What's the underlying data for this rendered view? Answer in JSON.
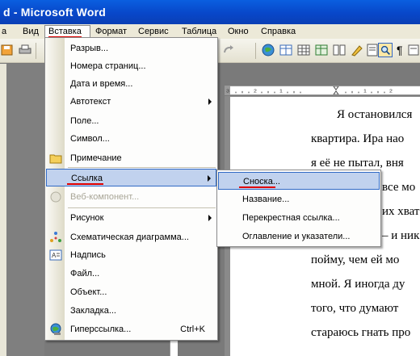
{
  "window": {
    "title": "d - Microsoft Word"
  },
  "menubar": {
    "items": [
      {
        "label": "а"
      },
      {
        "label": "Вид"
      },
      {
        "label": "Вставка"
      },
      {
        "label": "Формат"
      },
      {
        "label": "Сервис"
      },
      {
        "label": "Таблица"
      },
      {
        "label": "Окно"
      },
      {
        "label": "Справка"
      }
    ]
  },
  "insert_menu": {
    "items": [
      {
        "label": "Разрыв..."
      },
      {
        "label": "Номера страниц..."
      },
      {
        "label": "Дата и время..."
      },
      {
        "label": "Автотекст"
      },
      {
        "label": "Поле..."
      },
      {
        "label": "Символ..."
      },
      {
        "label": "Примечание"
      },
      {
        "label": "Ссылка"
      },
      {
        "label": "Веб-компонент..."
      },
      {
        "label": "Рисунок"
      },
      {
        "label": "Схематическая диаграмма..."
      },
      {
        "label": "Надпись"
      },
      {
        "label": "Файл..."
      },
      {
        "label": "Объект..."
      },
      {
        "label": "Закладка..."
      },
      {
        "label": "Гиперссылка...",
        "shortcut": "Ctrl+K"
      }
    ]
  },
  "reference_submenu": {
    "items": [
      {
        "label": "Сноска..."
      },
      {
        "label": "Название..."
      },
      {
        "label": "Перекрестная ссылка..."
      },
      {
        "label": "Оглавление и указатели..."
      }
    ]
  },
  "document": {
    "lines": [
      "Я остановился",
      "квартира. Ира нао",
      "я её не пытал, вня",
      "все мо",
      "их хват",
      "– и ник",
      "пойму, чем ей мо",
      "мной. Я иногда ду",
      "того, что думают",
      "стараюсь гнать про"
    ]
  },
  "colors": {
    "highlight": "#c1d2ee",
    "underline_marker": "#e00000",
    "title_bar": "#0847c9"
  }
}
